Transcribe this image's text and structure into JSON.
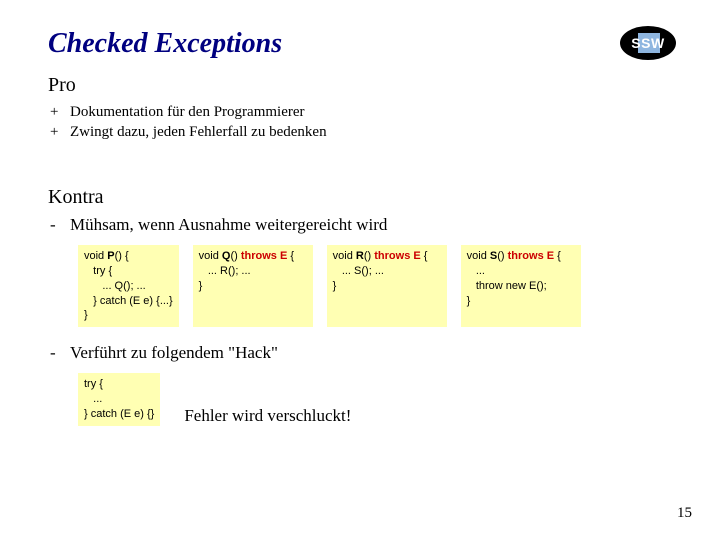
{
  "title": "Checked Exceptions",
  "logo": {
    "text": "SSW"
  },
  "pro": {
    "heading": "Pro",
    "items": [
      "Dokumentation für den Programmierer",
      "Zwingt dazu, jeden Fehlerfall zu bedenken"
    ]
  },
  "kontra": {
    "heading": "Kontra",
    "item1": "Mühsam, wenn Ausnahme weitergereicht wird",
    "item2": "Verführt zu folgendem \"Hack\"",
    "code_boxes": [
      {
        "sig_pre": "void ",
        "fn": "P",
        "sig_post": "() {",
        "throws": "",
        "body": "   try {\n      ... Q(); ...\n   } catch (E e) {...}\n}"
      },
      {
        "sig_pre": "void ",
        "fn": "Q",
        "sig_post": "() ",
        "throws": "throws E",
        "sig_tail": " {",
        "body": "   ... R(); ...\n}"
      },
      {
        "sig_pre": "void ",
        "fn": "R",
        "sig_post": "() ",
        "throws": "throws E",
        "sig_tail": " {",
        "body": "   ... S(); ...\n}"
      },
      {
        "sig_pre": "void ",
        "fn": "S",
        "sig_post": "() ",
        "throws": "throws E",
        "sig_tail": " {",
        "body": "   ...\n   throw new E();\n}"
      }
    ],
    "hack_code": "try {\n   ...\n} catch (E e) {}",
    "hack_msg": "Fehler wird verschluckt!"
  },
  "page_number": "15"
}
